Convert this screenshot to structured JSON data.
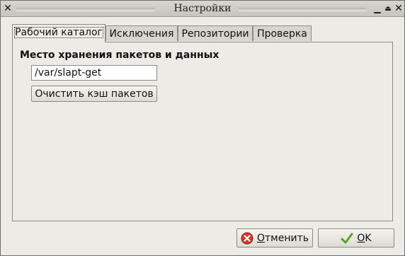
{
  "window": {
    "title": "Настройки"
  },
  "tabs": [
    {
      "label": "Рабочий каталог",
      "active": true
    },
    {
      "label": "Исключения",
      "active": false
    },
    {
      "label": "Репозитории",
      "active": false
    },
    {
      "label": "Проверка",
      "active": false
    }
  ],
  "working_dir": {
    "section_title": "Место хранения пакетов и данных",
    "path_value": "/var/slapt-get",
    "clear_cache_label": "Очистить кэш пакетов"
  },
  "footer": {
    "cancel_label": "Отменить",
    "cancel_mnemonic": "О",
    "cancel_rest": "тменить",
    "ok_label": "OK",
    "ok_mnemonic": "O",
    "ok_rest": "K"
  },
  "icons": {
    "titlebar_close": "close-icon",
    "titlebar_minimize": "minimize-icon",
    "titlebar_shade": "shade-icon",
    "cancel": "cancel-icon",
    "ok": "checkmark-icon"
  },
  "colors": {
    "window_bg": "#ecebe6",
    "cancel_icon": "#d9352c",
    "ok_icon": "#5aa32a"
  }
}
